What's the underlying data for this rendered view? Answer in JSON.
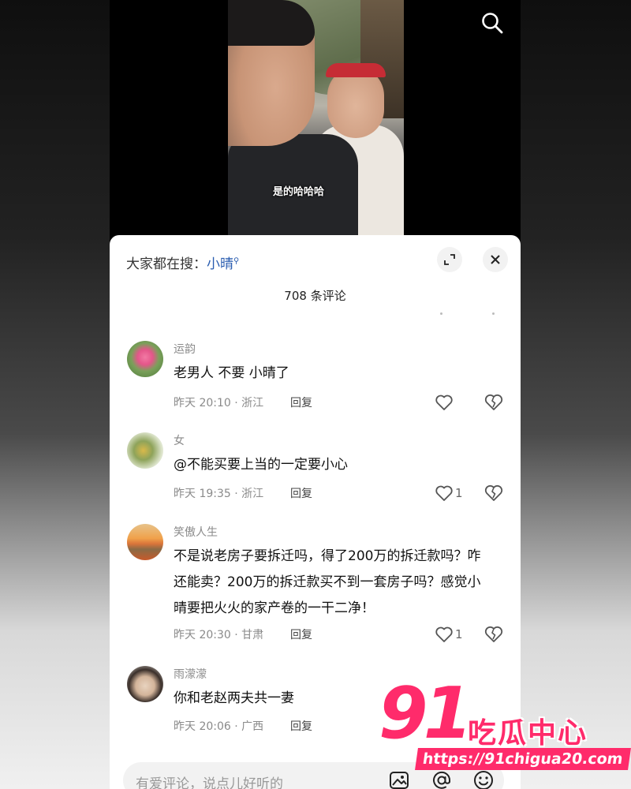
{
  "video": {
    "subtitle": "是的哈哈哈"
  },
  "panel": {
    "hot_search_prefix": "大家都在搜：",
    "hot_search_keyword": "小晴",
    "comment_count": "708 条评论"
  },
  "comments": [
    {
      "name": "运韵",
      "text": "老男人 不要 小晴了",
      "meta": "昨天 20:10 · 浙江",
      "reply": "回复",
      "likes": ""
    },
    {
      "name": "女",
      "text": "@不能买要上当的一定要小心",
      "meta": "昨天 19:35 · 浙江",
      "reply": "回复",
      "likes": "1"
    },
    {
      "name": "笑傲人生",
      "text": "不是说老房子要拆迁吗，得了200万的拆迁款吗？咋还能卖？200万的拆迁款买不到一套房子吗？感觉小晴要把火火的家产卷的一干二净！",
      "meta": "昨天 20:30 · 甘肃",
      "reply": "回复",
      "likes": "1"
    },
    {
      "name": "雨濛濛",
      "text": "你和老赵两夫共一妻",
      "meta": "昨天 20:06 · 广西",
      "reply": "回复",
      "likes": ""
    }
  ],
  "input": {
    "placeholder": "有爱评论，说点儿好听的"
  },
  "watermark": {
    "number": "91",
    "text": "吃瓜中心",
    "url": "https://91chigua20.com"
  },
  "colors": {
    "accent_link": "#2a5db0",
    "watermark": "#ff2b6b"
  }
}
